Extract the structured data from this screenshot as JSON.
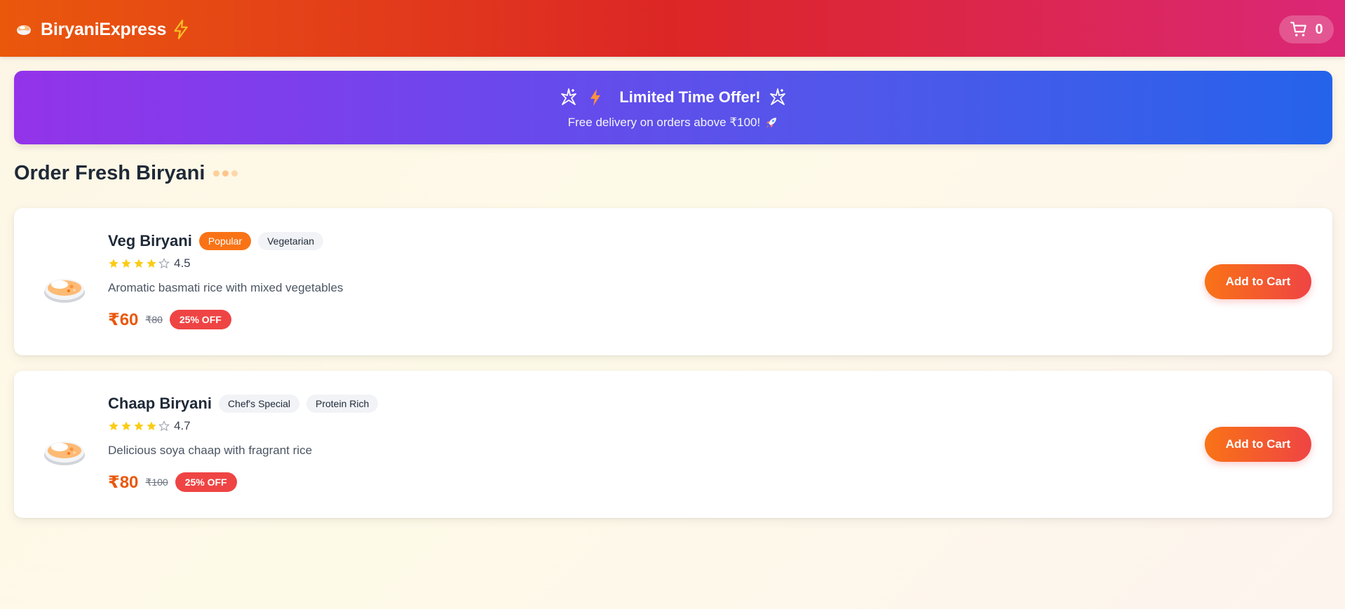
{
  "header": {
    "brand_name": "BiryaniExpress",
    "logo_icon": "biryani-bowl-icon",
    "brand_accent_icon": "lightning-icon",
    "cart_icon": "shopping-cart-icon",
    "cart_count": "0"
  },
  "promo": {
    "title": "Limited Time Offer!",
    "subtitle": "Free delivery on orders above ₹100!",
    "icons": [
      "sparkle-icon",
      "lightning-icon",
      "sparkle-icon",
      "rocket-icon"
    ]
  },
  "section": {
    "title": "Order Fresh Biryani"
  },
  "products": [
    {
      "name": "Veg Biryani",
      "tags": [
        "Popular",
        "Vegetarian"
      ],
      "rating": "4.5",
      "stars_filled": 4,
      "description": "Aromatic basmati rice with mixed vegetables",
      "price": "₹60",
      "old_price": "₹80",
      "discount": "25% OFF",
      "button": "Add to Cart"
    },
    {
      "name": "Chaap Biryani",
      "tags": [
        "Chef's Special",
        "Protein Rich"
      ],
      "rating": "4.7",
      "stars_filled": 4,
      "description": "Delicious soya chaap with fragrant rice",
      "price": "₹80",
      "old_price": "₹100",
      "discount": "25% OFF",
      "button": "Add to Cart"
    }
  ],
  "colors": {
    "header_start": "#ea580c",
    "header_mid": "#dc2626",
    "header_end": "#db2777",
    "promo_start": "#9333ea",
    "promo_end": "#2563eb",
    "price": "#ea580c",
    "discount_badge": "#ef4444",
    "popular_tag": "#f97316",
    "star": "#facc15"
  }
}
